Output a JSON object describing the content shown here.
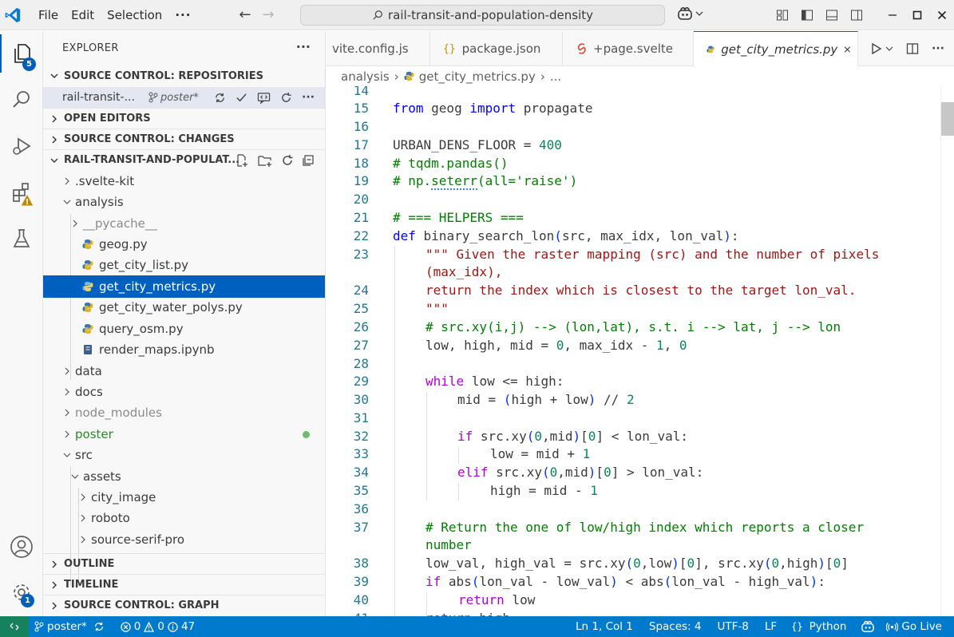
{
  "titlebar": {
    "menu": [
      "File",
      "Edit",
      "Selection",
      "···"
    ],
    "search_text": "rail-transit-and-population-density"
  },
  "activity": {
    "explorer_badge": "5",
    "settings_badge": "1"
  },
  "sidebar": {
    "title": "EXPLORER",
    "sections": {
      "repositories": "SOURCE CONTROL: REPOSITORIES",
      "open_editors": "OPEN EDITORS",
      "changes": "SOURCE CONTROL: CHANGES",
      "workspace": "RAIL-TRANSIT-AND-POPULAT...",
      "outline": "OUTLINE",
      "timeline": "TIMELINE",
      "graph": "SOURCE CONTROL: GRAPH"
    },
    "repo": {
      "name": "rail-transit-...",
      "branch": "poster*"
    },
    "tree": [
      ".svelte-kit",
      "analysis",
      "__pycache__",
      "geog.py",
      "get_city_list.py",
      "get_city_metrics.py",
      "get_city_water_polys.py",
      "query_osm.py",
      "render_maps.ipynb",
      "data",
      "docs",
      "node_modules",
      "poster",
      "src",
      "assets",
      "city_image",
      "roboto",
      "source-serif-pro"
    ]
  },
  "tabs": [
    "vite.config.js",
    "package.json",
    "+page.svelte",
    "get_city_metrics.py"
  ],
  "breadcrumb": [
    "analysis",
    "get_city_metrics.py",
    "..."
  ],
  "editor": {
    "line_numbers": [
      "14",
      "15",
      "16",
      "17",
      "18",
      "19",
      "20",
      "21",
      "22",
      "23",
      "",
      "24",
      "25",
      "26",
      "27",
      "28",
      "29",
      "30",
      "31",
      "32",
      "33",
      "34",
      "35",
      "36",
      "37",
      "",
      "38",
      "39",
      "40",
      "41"
    ]
  },
  "status": {
    "branch": "poster*",
    "errors": "0",
    "warnings": "0",
    "info": "47",
    "position": "Ln 1, Col 1",
    "spaces": "Spaces: 4",
    "encoding": "UTF-8",
    "eol": "LF",
    "language": "Python",
    "golive": "Go Live"
  },
  "colors": {
    "accent": "#005fb8",
    "statusbar": "#007acc",
    "selection": "#0060c0"
  }
}
